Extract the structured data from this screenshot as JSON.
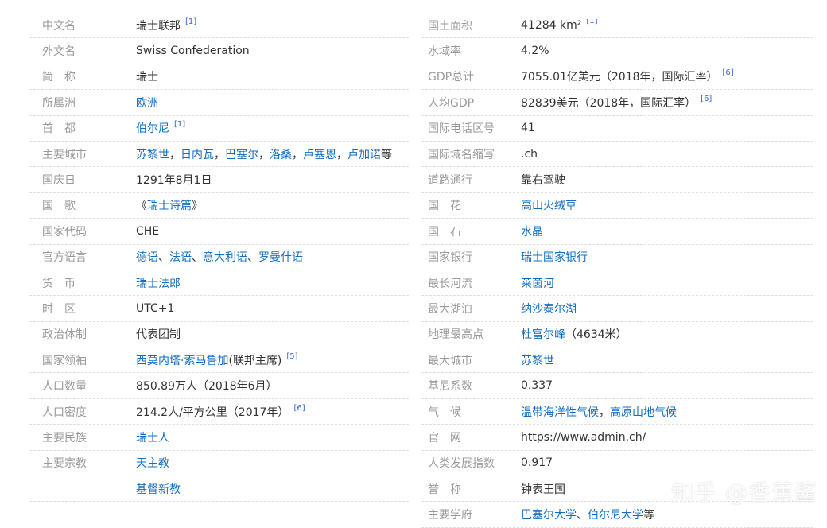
{
  "left": [
    {
      "label": "中文名",
      "value": [
        {
          "t": "瑞士联邦",
          "link": false
        }
      ],
      "ref": "[1]"
    },
    {
      "label": "外文名",
      "value": [
        {
          "t": "Swiss Confederation",
          "link": false
        }
      ]
    },
    {
      "label": "简　称",
      "value": [
        {
          "t": "瑞士",
          "link": false
        }
      ]
    },
    {
      "label": "所属洲",
      "value": [
        {
          "t": "欧洲",
          "link": true
        }
      ]
    },
    {
      "label": "首　都",
      "value": [
        {
          "t": "伯尔尼",
          "link": true
        }
      ],
      "ref": "[1]"
    },
    {
      "label": "主要城市",
      "value": [
        {
          "t": "苏黎世",
          "link": true
        },
        {
          "t": "，",
          "link": false
        },
        {
          "t": "日内瓦",
          "link": true
        },
        {
          "t": "，",
          "link": false
        },
        {
          "t": "巴塞尔",
          "link": true
        },
        {
          "t": "，",
          "link": false
        },
        {
          "t": "洛桑",
          "link": true
        },
        {
          "t": "，",
          "link": false
        },
        {
          "t": "卢塞恩",
          "link": true
        },
        {
          "t": "，",
          "link": false
        },
        {
          "t": "卢加诺",
          "link": true
        },
        {
          "t": "等",
          "link": false
        }
      ]
    },
    {
      "label": "国庆日",
      "value": [
        {
          "t": "1291年8月1日",
          "link": false
        }
      ]
    },
    {
      "label": "国　歌",
      "value": [
        {
          "t": "《",
          "link": false
        },
        {
          "t": "瑞士诗篇",
          "link": true
        },
        {
          "t": "》",
          "link": false
        }
      ]
    },
    {
      "label": "国家代码",
      "value": [
        {
          "t": "CHE",
          "link": false
        }
      ]
    },
    {
      "label": "官方语言",
      "value": [
        {
          "t": "德语",
          "link": true
        },
        {
          "t": "、",
          "link": false
        },
        {
          "t": "法语",
          "link": true
        },
        {
          "t": "、",
          "link": false
        },
        {
          "t": "意大利语",
          "link": true
        },
        {
          "t": "、",
          "link": false
        },
        {
          "t": "罗曼什语",
          "link": true
        }
      ]
    },
    {
      "label": "货　币",
      "value": [
        {
          "t": "瑞士法郎",
          "link": true
        }
      ]
    },
    {
      "label": "时　区",
      "value": [
        {
          "t": "UTC+1",
          "link": false
        }
      ]
    },
    {
      "label": "政治体制",
      "value": [
        {
          "t": "代表团制",
          "link": false
        }
      ]
    },
    {
      "label": "国家领袖",
      "value": [
        {
          "t": "西莫内塔·索马鲁加",
          "link": true
        },
        {
          "t": "(联邦主席)",
          "link": false
        }
      ],
      "ref": "[5]"
    },
    {
      "label": "人口数量",
      "value": [
        {
          "t": "850.89万人（2018年6月）",
          "link": false
        }
      ]
    },
    {
      "label": "人口密度",
      "value": [
        {
          "t": "214.2人/平方公里（2017年）",
          "link": false
        }
      ],
      "ref": "[6]"
    },
    {
      "label": "主要民族",
      "value": [
        {
          "t": "瑞士人",
          "link": true
        }
      ]
    },
    {
      "label": "主要宗教",
      "value": [
        {
          "t": "天主教",
          "link": true
        }
      ]
    },
    {
      "label": "",
      "value": [
        {
          "t": "基督新教",
          "link": true
        }
      ]
    }
  ],
  "right": [
    {
      "label": "国土面积",
      "value": [
        {
          "t": "41284 km²",
          "link": false
        }
      ],
      "ref": "[1]"
    },
    {
      "label": "水域率",
      "value": [
        {
          "t": "4.2%",
          "link": false
        }
      ]
    },
    {
      "label": "GDP总计",
      "value": [
        {
          "t": "7055.01亿美元（2018年，国际汇率）",
          "link": false
        }
      ],
      "ref": "[6]"
    },
    {
      "label": "人均GDP",
      "value": [
        {
          "t": "82839美元（2018年，国际汇率）",
          "link": false
        }
      ],
      "ref": "[6]"
    },
    {
      "label": "国际电话区号",
      "value": [
        {
          "t": "41",
          "link": false
        }
      ]
    },
    {
      "label": "国际域名缩写",
      "value": [
        {
          "t": ".ch",
          "link": false
        }
      ]
    },
    {
      "label": "道路通行",
      "value": [
        {
          "t": "靠右驾驶",
          "link": false
        }
      ]
    },
    {
      "label": "国　花",
      "value": [
        {
          "t": "高山火绒草",
          "link": true
        }
      ]
    },
    {
      "label": "国　石",
      "value": [
        {
          "t": "水晶",
          "link": true
        }
      ]
    },
    {
      "label": "国家银行",
      "value": [
        {
          "t": "瑞士国家银行",
          "link": true
        }
      ]
    },
    {
      "label": "最长河流",
      "value": [
        {
          "t": "莱茵河",
          "link": true
        }
      ]
    },
    {
      "label": "最大湖泊",
      "value": [
        {
          "t": "纳沙泰尔湖",
          "link": true
        }
      ]
    },
    {
      "label": "地理最高点",
      "value": [
        {
          "t": "杜富尔峰",
          "link": true
        },
        {
          "t": "（4634米）",
          "link": false
        }
      ]
    },
    {
      "label": "最大城市",
      "value": [
        {
          "t": "苏黎世",
          "link": true
        }
      ]
    },
    {
      "label": "基尼系数",
      "value": [
        {
          "t": "0.337",
          "link": false
        }
      ]
    },
    {
      "label": "气　候",
      "value": [
        {
          "t": "温带海洋性气候",
          "link": true
        },
        {
          "t": "，",
          "link": false
        },
        {
          "t": "高原山地气候",
          "link": true
        }
      ]
    },
    {
      "label": "官　网",
      "value": [
        {
          "t": "https://www.admin.ch/",
          "link": false
        }
      ]
    },
    {
      "label": "人类发展指数",
      "value": [
        {
          "t": "0.917",
          "link": false
        }
      ]
    },
    {
      "label": "誉　称",
      "value": [
        {
          "t": "钟表王国",
          "link": false
        }
      ]
    },
    {
      "label": "主要学府",
      "value": [
        {
          "t": "巴塞尔大学",
          "link": true
        },
        {
          "t": "、",
          "link": false
        },
        {
          "t": "伯尔尼大学",
          "link": true
        },
        {
          "t": "等",
          "link": false
        }
      ]
    }
  ],
  "watermark": "知乎 @香蕉酱"
}
